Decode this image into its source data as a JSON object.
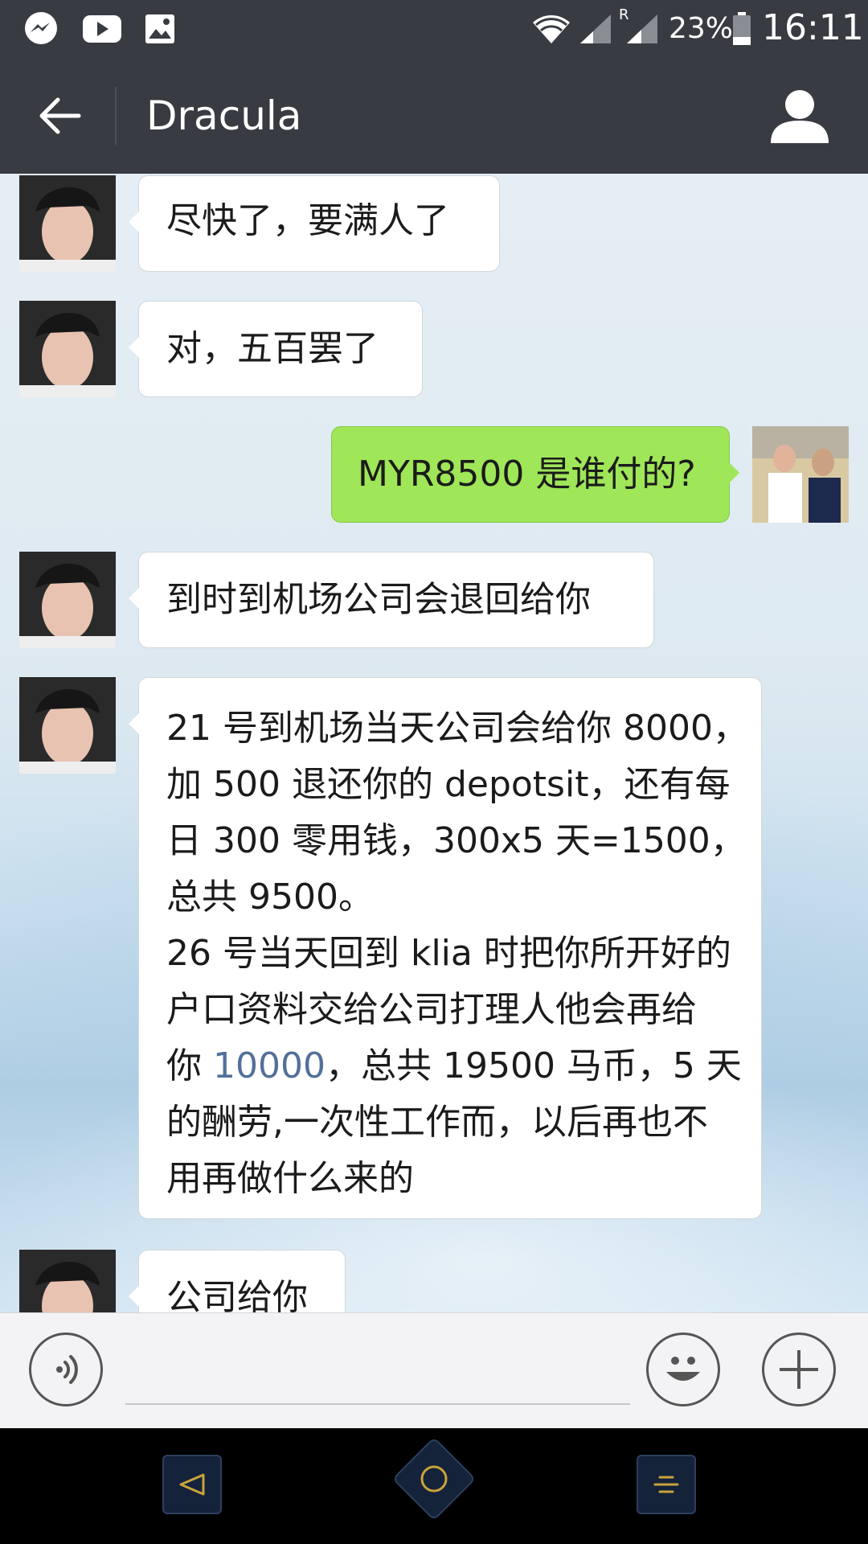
{
  "status_bar": {
    "battery_percent": "23%",
    "time": "16:11",
    "roaming_indicator": "R",
    "icons": [
      "messenger-icon",
      "youtube-icon",
      "gallery-icon",
      "wifi-icon",
      "signal-icon",
      "signal-roaming-icon",
      "battery-icon"
    ]
  },
  "header": {
    "title": "Dracula",
    "back_icon": "arrow-left-icon",
    "profile_icon": "person-icon"
  },
  "messages": [
    {
      "side": "in",
      "lines": [
        "尽快了，要满人了"
      ]
    },
    {
      "side": "in",
      "lines": [
        "对，五百罢了"
      ]
    },
    {
      "side": "out",
      "lines": [
        "MYR8500 是谁付的?"
      ]
    },
    {
      "side": "in",
      "lines": [
        "到时到机场公司会退回给你"
      ]
    },
    {
      "side": "in",
      "lines": [
        "21 号到机场当天公司会给你 8000，",
        "加 500 退还你的 depotsit，还有每",
        "日 300 零用钱，300x5 天=1500，",
        "总共 9500。",
        "26 号当天回到 klia 时把你所开好的",
        "户口资料交给公司打理人他会再给"
      ],
      "line7_prefix": "你 ",
      "line7_link": "10000",
      "line7_suffix": "，总共 19500 马币，5 天",
      "lines_after": [
        "的酬劳,一次性工作而，以后再也不",
        "用再做什么来的"
      ]
    },
    {
      "side": "in",
      "lines": [
        "公司给你"
      ]
    }
  ],
  "input_bar": {
    "voice_icon": "voice-icon",
    "emoji_icon": "smiley-icon",
    "plus_icon": "plus-icon",
    "input_value": ""
  },
  "nav_bar": {
    "icons": [
      "nav-back-icon",
      "nav-home-icon",
      "nav-menu-icon"
    ]
  },
  "colors": {
    "header_bg": "#383c42",
    "incoming_bubble": "#ffffff",
    "outgoing_bubble": "#9fe658",
    "link": "#52709a"
  }
}
